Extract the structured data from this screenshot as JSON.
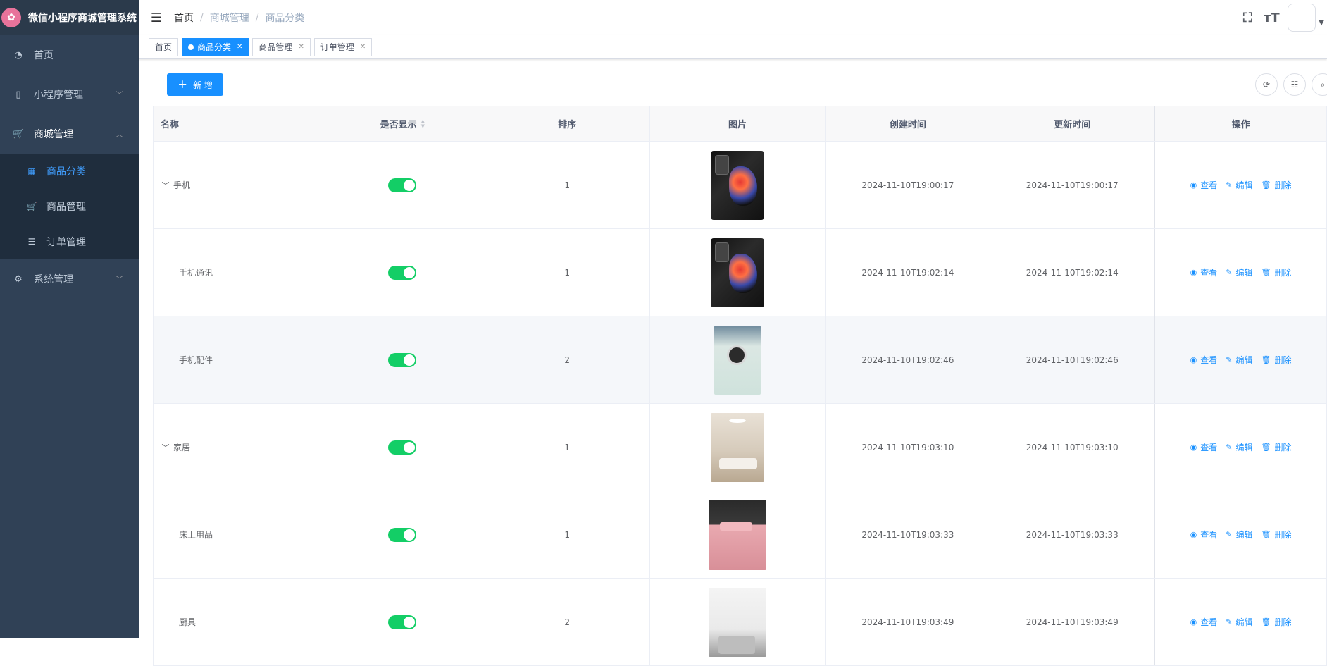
{
  "app": {
    "title": "微信小程序商城管理系统"
  },
  "sidebar": {
    "items": [
      {
        "label": "首页",
        "icon": "dashboard-icon"
      },
      {
        "label": "小程序管理",
        "icon": "phone-icon"
      },
      {
        "label": "商城管理",
        "icon": "cart-icon"
      },
      {
        "label": "系统管理",
        "icon": "gear-icon"
      }
    ],
    "sub_items": [
      {
        "label": "商品分类",
        "icon": "grid-icon"
      },
      {
        "label": "商品管理",
        "icon": "cart-icon"
      },
      {
        "label": "订单管理",
        "icon": "list-icon"
      }
    ]
  },
  "header": {
    "breadcrumb": [
      "首页",
      "商城管理",
      "商品分类"
    ]
  },
  "tags": [
    {
      "label": "首页"
    },
    {
      "label": "商品分类"
    },
    {
      "label": "商品管理"
    },
    {
      "label": "订单管理"
    }
  ],
  "toolbar": {
    "add_label": "新 增"
  },
  "table": {
    "columns": [
      "名称",
      "是否显示",
      "排序",
      "图片",
      "创建时间",
      "更新时间",
      "操作"
    ],
    "actions": {
      "view": "查看",
      "edit": "编辑",
      "delete": "删除"
    },
    "rows": [
      {
        "name": "手机",
        "show": true,
        "sort": "1",
        "image": "phone",
        "created": "2024-11-10T19:00:17",
        "updated": "2024-11-10T19:00:17"
      },
      {
        "name": "手机通讯",
        "show": true,
        "sort": "1",
        "image": "phone",
        "created": "2024-11-10T19:02:14",
        "updated": "2024-11-10T19:02:14"
      },
      {
        "name": "手机配件",
        "show": true,
        "sort": "2",
        "image": "phone-case",
        "created": "2024-11-10T19:02:46",
        "updated": "2024-11-10T19:02:46"
      },
      {
        "name": "家居",
        "show": true,
        "sort": "1",
        "image": "living-room",
        "created": "2024-11-10T19:03:10",
        "updated": "2024-11-10T19:03:10"
      },
      {
        "name": "床上用品",
        "show": true,
        "sort": "1",
        "image": "bedding",
        "created": "2024-11-10T19:03:33",
        "updated": "2024-11-10T19:03:33"
      },
      {
        "name": "厨具",
        "show": true,
        "sort": "2",
        "image": "cookware",
        "created": "2024-11-10T19:03:49",
        "updated": "2024-11-10T19:03:49"
      }
    ]
  },
  "colors": {
    "sidebar_bg": "#304156",
    "submenu_bg": "#1f2d3d",
    "primary": "#1890ff",
    "switch_on": "#13ce66"
  }
}
